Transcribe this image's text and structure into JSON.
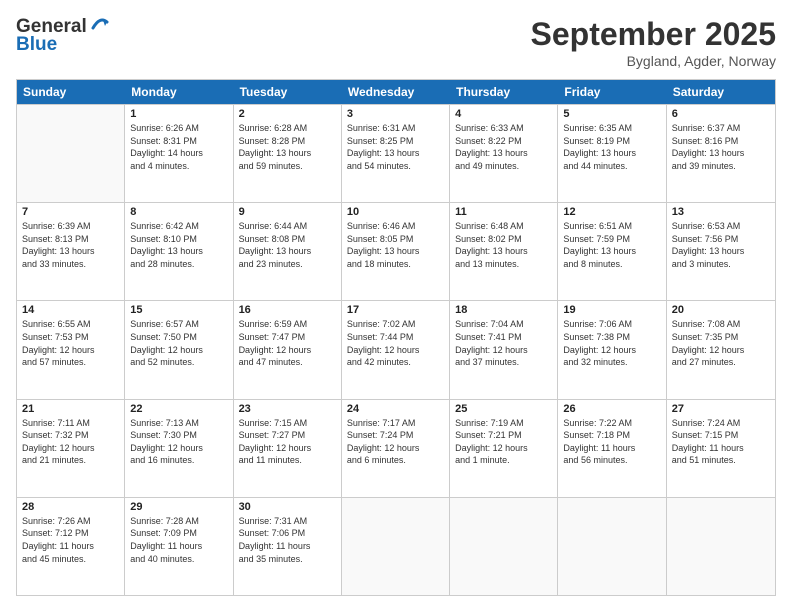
{
  "header": {
    "logo_line1": "General",
    "logo_line2": "Blue",
    "month": "September 2025",
    "location": "Bygland, Agder, Norway"
  },
  "weekdays": [
    "Sunday",
    "Monday",
    "Tuesday",
    "Wednesday",
    "Thursday",
    "Friday",
    "Saturday"
  ],
  "rows": [
    [
      {
        "day": "",
        "info": ""
      },
      {
        "day": "1",
        "info": "Sunrise: 6:26 AM\nSunset: 8:31 PM\nDaylight: 14 hours\nand 4 minutes."
      },
      {
        "day": "2",
        "info": "Sunrise: 6:28 AM\nSunset: 8:28 PM\nDaylight: 13 hours\nand 59 minutes."
      },
      {
        "day": "3",
        "info": "Sunrise: 6:31 AM\nSunset: 8:25 PM\nDaylight: 13 hours\nand 54 minutes."
      },
      {
        "day": "4",
        "info": "Sunrise: 6:33 AM\nSunset: 8:22 PM\nDaylight: 13 hours\nand 49 minutes."
      },
      {
        "day": "5",
        "info": "Sunrise: 6:35 AM\nSunset: 8:19 PM\nDaylight: 13 hours\nand 44 minutes."
      },
      {
        "day": "6",
        "info": "Sunrise: 6:37 AM\nSunset: 8:16 PM\nDaylight: 13 hours\nand 39 minutes."
      }
    ],
    [
      {
        "day": "7",
        "info": "Sunrise: 6:39 AM\nSunset: 8:13 PM\nDaylight: 13 hours\nand 33 minutes."
      },
      {
        "day": "8",
        "info": "Sunrise: 6:42 AM\nSunset: 8:10 PM\nDaylight: 13 hours\nand 28 minutes."
      },
      {
        "day": "9",
        "info": "Sunrise: 6:44 AM\nSunset: 8:08 PM\nDaylight: 13 hours\nand 23 minutes."
      },
      {
        "day": "10",
        "info": "Sunrise: 6:46 AM\nSunset: 8:05 PM\nDaylight: 13 hours\nand 18 minutes."
      },
      {
        "day": "11",
        "info": "Sunrise: 6:48 AM\nSunset: 8:02 PM\nDaylight: 13 hours\nand 13 minutes."
      },
      {
        "day": "12",
        "info": "Sunrise: 6:51 AM\nSunset: 7:59 PM\nDaylight: 13 hours\nand 8 minutes."
      },
      {
        "day": "13",
        "info": "Sunrise: 6:53 AM\nSunset: 7:56 PM\nDaylight: 13 hours\nand 3 minutes."
      }
    ],
    [
      {
        "day": "14",
        "info": "Sunrise: 6:55 AM\nSunset: 7:53 PM\nDaylight: 12 hours\nand 57 minutes."
      },
      {
        "day": "15",
        "info": "Sunrise: 6:57 AM\nSunset: 7:50 PM\nDaylight: 12 hours\nand 52 minutes."
      },
      {
        "day": "16",
        "info": "Sunrise: 6:59 AM\nSunset: 7:47 PM\nDaylight: 12 hours\nand 47 minutes."
      },
      {
        "day": "17",
        "info": "Sunrise: 7:02 AM\nSunset: 7:44 PM\nDaylight: 12 hours\nand 42 minutes."
      },
      {
        "day": "18",
        "info": "Sunrise: 7:04 AM\nSunset: 7:41 PM\nDaylight: 12 hours\nand 37 minutes."
      },
      {
        "day": "19",
        "info": "Sunrise: 7:06 AM\nSunset: 7:38 PM\nDaylight: 12 hours\nand 32 minutes."
      },
      {
        "day": "20",
        "info": "Sunrise: 7:08 AM\nSunset: 7:35 PM\nDaylight: 12 hours\nand 27 minutes."
      }
    ],
    [
      {
        "day": "21",
        "info": "Sunrise: 7:11 AM\nSunset: 7:32 PM\nDaylight: 12 hours\nand 21 minutes."
      },
      {
        "day": "22",
        "info": "Sunrise: 7:13 AM\nSunset: 7:30 PM\nDaylight: 12 hours\nand 16 minutes."
      },
      {
        "day": "23",
        "info": "Sunrise: 7:15 AM\nSunset: 7:27 PM\nDaylight: 12 hours\nand 11 minutes."
      },
      {
        "day": "24",
        "info": "Sunrise: 7:17 AM\nSunset: 7:24 PM\nDaylight: 12 hours\nand 6 minutes."
      },
      {
        "day": "25",
        "info": "Sunrise: 7:19 AM\nSunset: 7:21 PM\nDaylight: 12 hours\nand 1 minute."
      },
      {
        "day": "26",
        "info": "Sunrise: 7:22 AM\nSunset: 7:18 PM\nDaylight: 11 hours\nand 56 minutes."
      },
      {
        "day": "27",
        "info": "Sunrise: 7:24 AM\nSunset: 7:15 PM\nDaylight: 11 hours\nand 51 minutes."
      }
    ],
    [
      {
        "day": "28",
        "info": "Sunrise: 7:26 AM\nSunset: 7:12 PM\nDaylight: 11 hours\nand 45 minutes."
      },
      {
        "day": "29",
        "info": "Sunrise: 7:28 AM\nSunset: 7:09 PM\nDaylight: 11 hours\nand 40 minutes."
      },
      {
        "day": "30",
        "info": "Sunrise: 7:31 AM\nSunset: 7:06 PM\nDaylight: 11 hours\nand 35 minutes."
      },
      {
        "day": "",
        "info": ""
      },
      {
        "day": "",
        "info": ""
      },
      {
        "day": "",
        "info": ""
      },
      {
        "day": "",
        "info": ""
      }
    ]
  ]
}
